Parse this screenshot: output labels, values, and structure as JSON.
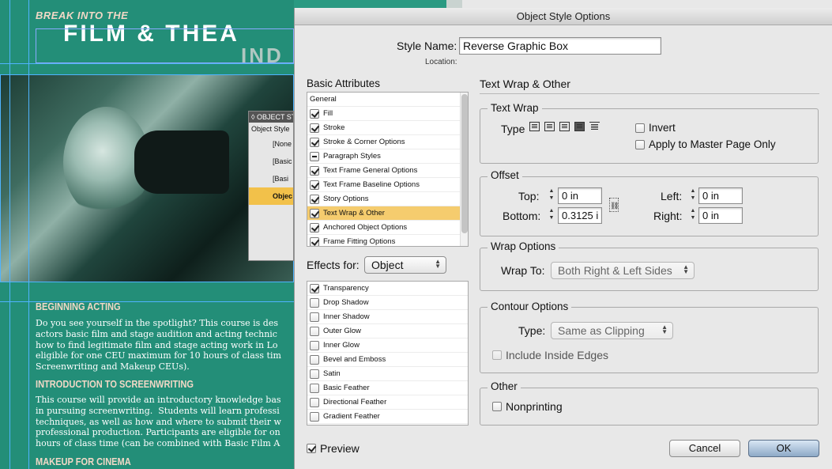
{
  "document": {
    "kicker": "BREAK INTO THE",
    "title": "FILM & THEA",
    "title_line2": "IND",
    "panel": {
      "title": "◊ OBJECT ST",
      "label": "Object Style",
      "items": [
        "[None",
        "[Basic",
        "[Basi",
        "Objec"
      ]
    },
    "sections": [
      {
        "heading": "BEGINNING ACTING",
        "body": "Do you see yourself in the spotlight? This course is des\nactors basic film and stage audition and acting technic\nhow to find legitimate film and stage acting work in Lo\neligible for one CEU maximum for 10 hours of class tim\nScreenwriting and Makeup CEUs)."
      },
      {
        "heading": "INTRODUCTION TO SCREENWRITING",
        "body": "This course will provide an introductory knowledge bas\nin pursuing screenwriting.  Students will learn professi\ntechniques, as well as how and where to submit their w\nprofessional production. Participants are eligible for on\nhours of class time (can be combined with Basic Film A"
      },
      {
        "heading": "MAKEUP FOR CINEMA",
        "body": ""
      }
    ]
  },
  "dialog": {
    "title": "Object Style Options",
    "style_name_label": "Style Name:",
    "style_name_value": "Reverse Graphic Box",
    "location_label": "Location:",
    "basic_attributes_label": "Basic Attributes",
    "basic_attributes": [
      {
        "label": "General",
        "state": "none"
      },
      {
        "label": "Fill",
        "state": "checked"
      },
      {
        "label": "Stroke",
        "state": "checked"
      },
      {
        "label": "Stroke & Corner Options",
        "state": "checked"
      },
      {
        "label": "Paragraph Styles",
        "state": "mixed"
      },
      {
        "label": "Text Frame General Options",
        "state": "checked"
      },
      {
        "label": "Text Frame Baseline Options",
        "state": "checked"
      },
      {
        "label": "Story Options",
        "state": "checked"
      },
      {
        "label": "Text Wrap & Other",
        "state": "checked",
        "selected": true
      },
      {
        "label": "Anchored Object Options",
        "state": "checked"
      },
      {
        "label": "Frame Fitting Options",
        "state": "checked"
      }
    ],
    "effects_for_label": "Effects for:",
    "effects_for_value": "Object",
    "effects": [
      {
        "label": "Transparency",
        "state": "checked"
      },
      {
        "label": "Drop Shadow",
        "state": "unchecked"
      },
      {
        "label": "Inner Shadow",
        "state": "unchecked"
      },
      {
        "label": "Outer Glow",
        "state": "unchecked"
      },
      {
        "label": "Inner Glow",
        "state": "unchecked"
      },
      {
        "label": "Bevel and Emboss",
        "state": "unchecked"
      },
      {
        "label": "Satin",
        "state": "unchecked"
      },
      {
        "label": "Basic Feather",
        "state": "unchecked"
      },
      {
        "label": "Directional Feather",
        "state": "unchecked"
      },
      {
        "label": "Gradient Feather",
        "state": "unchecked"
      }
    ],
    "preview_label": "Preview",
    "preview_checked": true,
    "section_title": "Text Wrap & Other",
    "text_wrap": {
      "group_label": "Text Wrap",
      "type_label": "Type",
      "types": [
        "no-wrap-icon",
        "wrap-bounding-box-icon",
        "wrap-object-shape-icon",
        "jump-object-icon",
        "jump-to-next-column-icon"
      ],
      "selected_type": 3,
      "invert_label": "Invert",
      "apply_master_label": "Apply to Master Page Only"
    },
    "offset": {
      "group_label": "Offset",
      "top_label": "Top:",
      "top_value": "0 in",
      "bottom_label": "Bottom:",
      "bottom_value": "0.3125 i",
      "left_label": "Left:",
      "left_value": "0 in",
      "right_label": "Right:",
      "right_value": "0 in"
    },
    "wrap_options": {
      "group_label": "Wrap Options",
      "wrap_to_label": "Wrap To:",
      "wrap_to_value": "Both Right & Left Sides"
    },
    "contour_options": {
      "group_label": "Contour Options",
      "type_label": "Type:",
      "type_value": "Same as Clipping",
      "include_inside_label": "Include Inside Edges"
    },
    "other": {
      "group_label": "Other",
      "nonprinting_label": "Nonprinting"
    },
    "cancel_label": "Cancel",
    "ok_label": "OK"
  },
  "colors": {
    "document_bg": "#2a9a82",
    "selection": "#f5cc6e",
    "dialog_bg": "#e8e8e8"
  }
}
